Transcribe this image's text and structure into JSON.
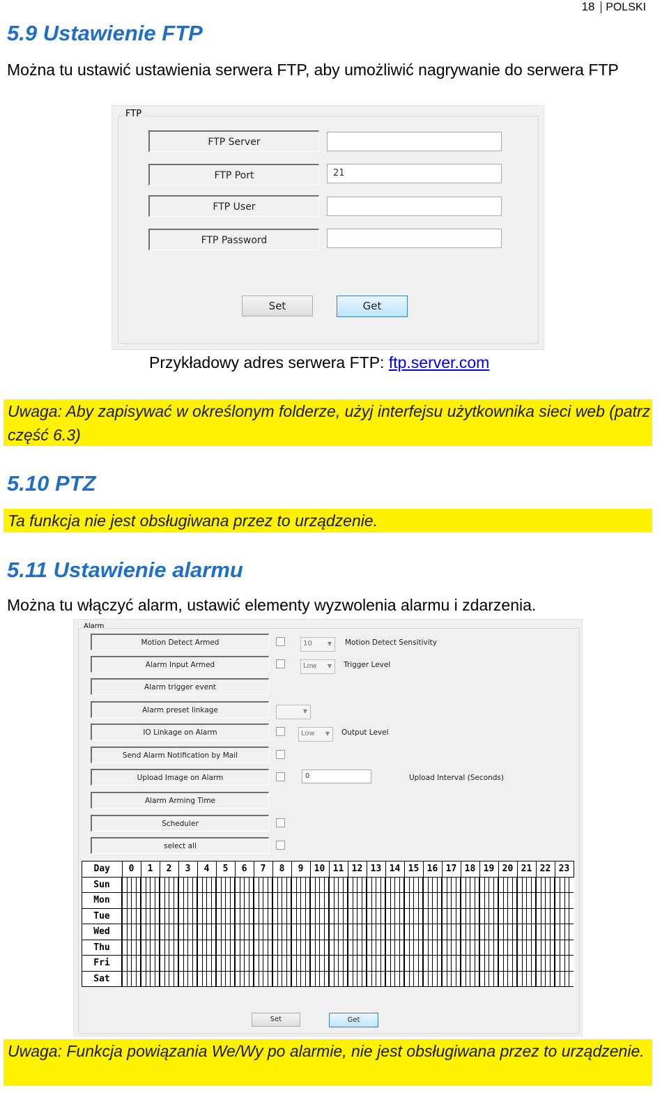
{
  "header": {
    "page_number": "18",
    "language": "POLSKI"
  },
  "ftp_section": {
    "title": "5.9 Ustawienie FTP",
    "intro": "Można tu ustawić ustawienia serwera FTP, aby umożliwić nagrywanie do serwera FTP",
    "panel": {
      "group_label": "FTP",
      "fields": [
        {
          "label": "FTP Server",
          "value": ""
        },
        {
          "label": "FTP Port",
          "value": "21"
        },
        {
          "label": "FTP User",
          "value": ""
        },
        {
          "label": "FTP Password",
          "value": ""
        }
      ],
      "set_label": "Set",
      "get_label": "Get"
    },
    "example_prefix": "Przykładowy adres serwera FTP: ",
    "example_link": "ftp.server.com",
    "note": "Uwaga: Aby zapisywać w określonym folderze, użyj interfejsu użytkownika sieci web (patrz część 6.3)"
  },
  "ptz_section": {
    "title": "5.10 PTZ",
    "note": "Ta funkcja nie jest obsługiwana przez to urządzenie."
  },
  "alarm_section": {
    "title": "5.11 Ustawienie alarmu",
    "intro": "Można tu włączyć alarm, ustawić elementy wyzwolenia alarmu i zdarzenia.",
    "panel": {
      "group_label": "Alarm",
      "rows": [
        {
          "label": "Motion Detect Armed",
          "checkbox": true,
          "dropdown": "10",
          "extra_label": "Motion Detect Sensitivity"
        },
        {
          "label": "Alarm Input Armed",
          "checkbox": true,
          "dropdown": "Low",
          "extra_label": "Trigger Level"
        },
        {
          "label": "Alarm trigger event"
        },
        {
          "label": "Alarm preset linkage",
          "dropdown": ""
        },
        {
          "label": "IO Linkage on Alarm",
          "checkbox": true,
          "dropdown": "Low",
          "extra_label": "Output Level"
        },
        {
          "label": "Send Alarm Notification by Mail",
          "checkbox": true
        },
        {
          "label": "Upload Image on Alarm",
          "checkbox": true,
          "input": "0",
          "extra_label": "Upload Interval (Seconds)"
        },
        {
          "label": "Alarm Arming Time"
        },
        {
          "label": "Scheduler",
          "checkbox": true
        },
        {
          "label": "select all",
          "checkbox": true
        }
      ],
      "schedule": {
        "corner": "Day",
        "hours": [
          "0",
          "1",
          "2",
          "3",
          "4",
          "5",
          "6",
          "7",
          "8",
          "9",
          "10",
          "11",
          "12",
          "13",
          "14",
          "15",
          "16",
          "17",
          "18",
          "19",
          "20",
          "21",
          "22",
          "23"
        ],
        "days": [
          "Sun",
          "Mon",
          "Tue",
          "Wed",
          "Thu",
          "Fri",
          "Sat"
        ]
      },
      "set_label": "Set",
      "get_label": "Get"
    },
    "note": "Uwaga: Funkcja powiązania We/Wy po alarmie, nie jest obsługiwana przez to urządzenie."
  },
  "colors": {
    "heading": "#1f6fc5",
    "highlight": "#fff200",
    "link": "#0000ee"
  }
}
